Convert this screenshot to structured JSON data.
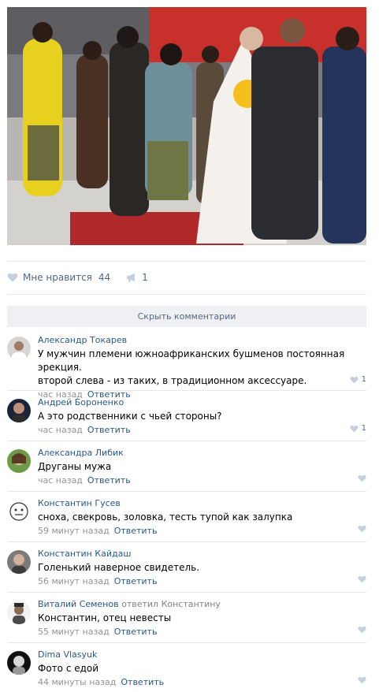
{
  "post": {
    "likes_label": "Мне нравится",
    "likes_count": "44",
    "shares_count": "1"
  },
  "comments_toggle": "Скрыть комментарии",
  "reply_label": "Ответить",
  "comments": [
    {
      "author": "Александр Токарев",
      "reply_to": "",
      "text_lines": [
        "У мужчин племени южноафриканских бушменов постоянная эрекция.",
        "второй слева - из таких, в традиционном аксессуаре."
      ],
      "time": "час назад",
      "likes": "1"
    },
    {
      "author": "Андрей Бороненко",
      "reply_to": "",
      "text_lines": [
        "А это родственники с чьей стороны?"
      ],
      "time": "час назад",
      "likes": "1"
    },
    {
      "author": "Александра Либик",
      "reply_to": "",
      "text_lines": [
        "Друганы мужа"
      ],
      "time": "час назад",
      "likes": ""
    },
    {
      "author": "Константин Гусев",
      "reply_to": "",
      "text_lines": [
        "сноха, свекровь, золовка, тесть тупой как залупка"
      ],
      "time": "59 минут назад",
      "likes": ""
    },
    {
      "author": "Константин Кайдаш",
      "reply_to": "",
      "text_lines": [
        "Голенький наверное свидетель."
      ],
      "time": "56 минут назад",
      "likes": ""
    },
    {
      "author": "Виталий Семенов",
      "reply_to": "ответил Константину",
      "text_lines": [
        "Константин, отец невесты"
      ],
      "time": "55 минут назад",
      "likes": ""
    },
    {
      "author": "Dima Vlasyuk",
      "reply_to": "",
      "text_lines": [
        "Фото с едой"
      ],
      "time": "44 минуты назад",
      "likes": ""
    }
  ]
}
